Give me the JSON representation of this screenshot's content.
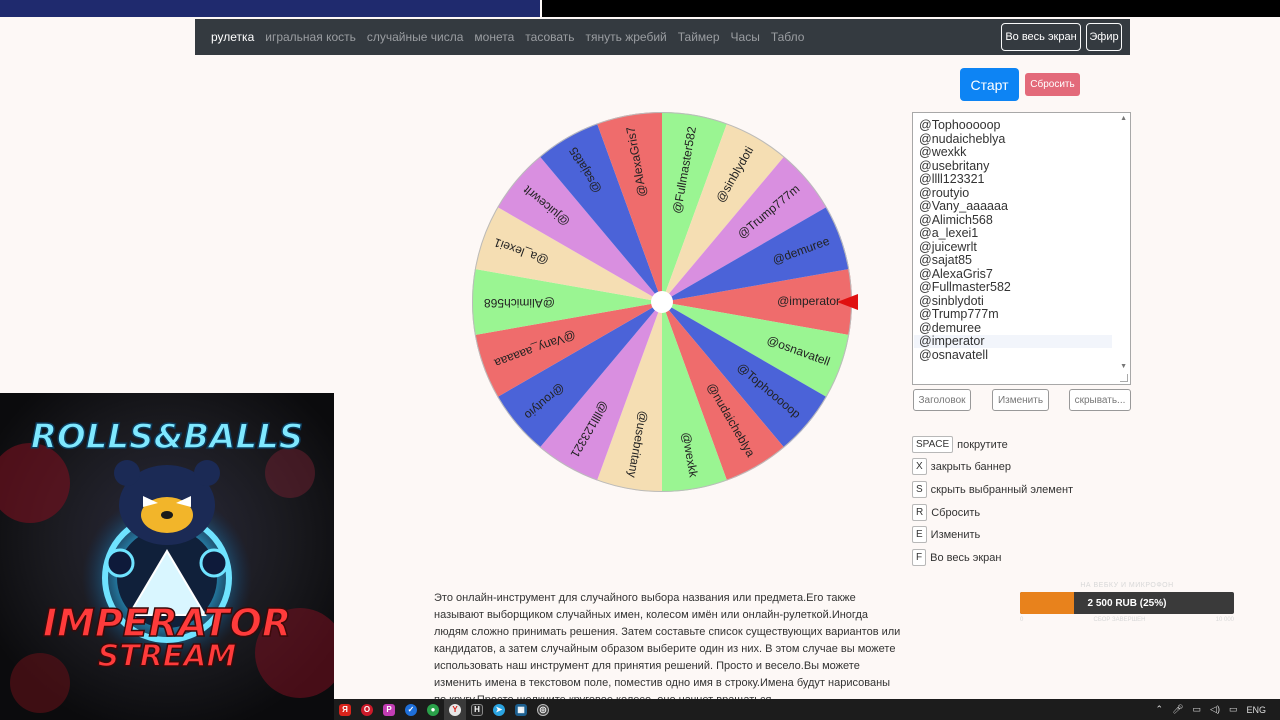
{
  "navbar": {
    "links": [
      "рулетка",
      "игральная кость",
      "случайные числа",
      "монета",
      "тасовать",
      "тянуть жребий",
      "Таймер",
      "Часы",
      "Табло"
    ],
    "fullscreen_label": "Во весь экран",
    "live_label": "Эфир"
  },
  "wheel": {
    "segments": [
      {
        "name": "@imperator",
        "color": "#ef6c6c"
      },
      {
        "name": "@osnavatell",
        "color": "#9af592"
      },
      {
        "name": "@Tophooooop",
        "color": "#4b63d8"
      },
      {
        "name": "@nudaicheblya",
        "color": "#ef6c6c"
      },
      {
        "name": "@wexkk",
        "color": "#9af592"
      },
      {
        "name": "@usebritany",
        "color": "#f5deb3"
      },
      {
        "name": "@llll123321",
        "color": "#d98fe0"
      },
      {
        "name": "@routyio",
        "color": "#4b63d8"
      },
      {
        "name": "@Vany_aaaaaa",
        "color": "#ef6c6c"
      },
      {
        "name": "@Alimich568",
        "color": "#9af592"
      },
      {
        "name": "@a_lexei1",
        "color": "#f5deb3"
      },
      {
        "name": "@juicewrlt",
        "color": "#d98fe0"
      },
      {
        "name": "@sajat85",
        "color": "#4b63d8"
      },
      {
        "name": "@AlexaGris7",
        "color": "#ef6c6c"
      },
      {
        "name": "@Fullmaster582",
        "color": "#9af592"
      },
      {
        "name": "@sinblydoti",
        "color": "#f5deb3"
      },
      {
        "name": "@Trump777m",
        "color": "#d98fe0"
      },
      {
        "name": "@demuree",
        "color": "#4b63d8"
      }
    ],
    "pointer_color": "#e01010"
  },
  "controls": {
    "start_label": "Старт",
    "reset_label": "Сбросить",
    "title_button": "Заголовок",
    "edit_button": "Изменить",
    "hide_button": "скрывать..."
  },
  "names_list": [
    "@Tophooooop",
    "@nudaicheblya",
    "@wexkk",
    "@usebritany",
    "@llll123321",
    "@routyio",
    "@Vany_aaaaaa",
    "@Alimich568",
    "@a_lexei1",
    "@juicewrlt",
    "@sajat85",
    "@AlexaGris7",
    "@Fullmaster582",
    "@sinblydoti",
    "@Trump777m",
    "@demuree",
    "@imperator",
    "@osnavatell"
  ],
  "shortcuts": [
    {
      "key": "SPACE",
      "label": "покрутите"
    },
    {
      "key": "X",
      "label": "закрыть баннер"
    },
    {
      "key": "S",
      "label": "скрыть выбранный элемент"
    },
    {
      "key": "R",
      "label": "Сбросить"
    },
    {
      "key": "E",
      "label": "Изменить"
    },
    {
      "key": "F",
      "label": "Во весь экран"
    }
  ],
  "description": "Это онлайн-инструмент для случайного выбора названия или предмета.Его также называют выборщиком случайных имен, колесом имён или онлайн-рулеткой.Иногда людям сложно принимать решения. Затем составьте список существующих вариантов или кандидатов, а затем случайным образом выберите один из них. В этом случае вы можете использовать наш инструмент для принятия решений. Просто и весело.Вы можете изменить имена в текстовом поле, поместив одно имя в строку.Имена будут нарисованы по кругу.Просто щелкните круговое колесо, оно начнет вращаться.",
  "webcam": {
    "title_top": "ROLLS&BALLS",
    "title_bottom_1": "IMPERATOR",
    "title_bottom_2": "STREAM"
  },
  "donation": {
    "title": "НА ВЕБКУ И МИКРОФОН",
    "amount_text": "2 500 RUB (25%)",
    "progress": 0.25,
    "min_label": "0",
    "mid_label": "СБОР ЗАВЕРШЕН",
    "max_label": "10 000"
  },
  "taskbar": {
    "language": "ENG"
  }
}
